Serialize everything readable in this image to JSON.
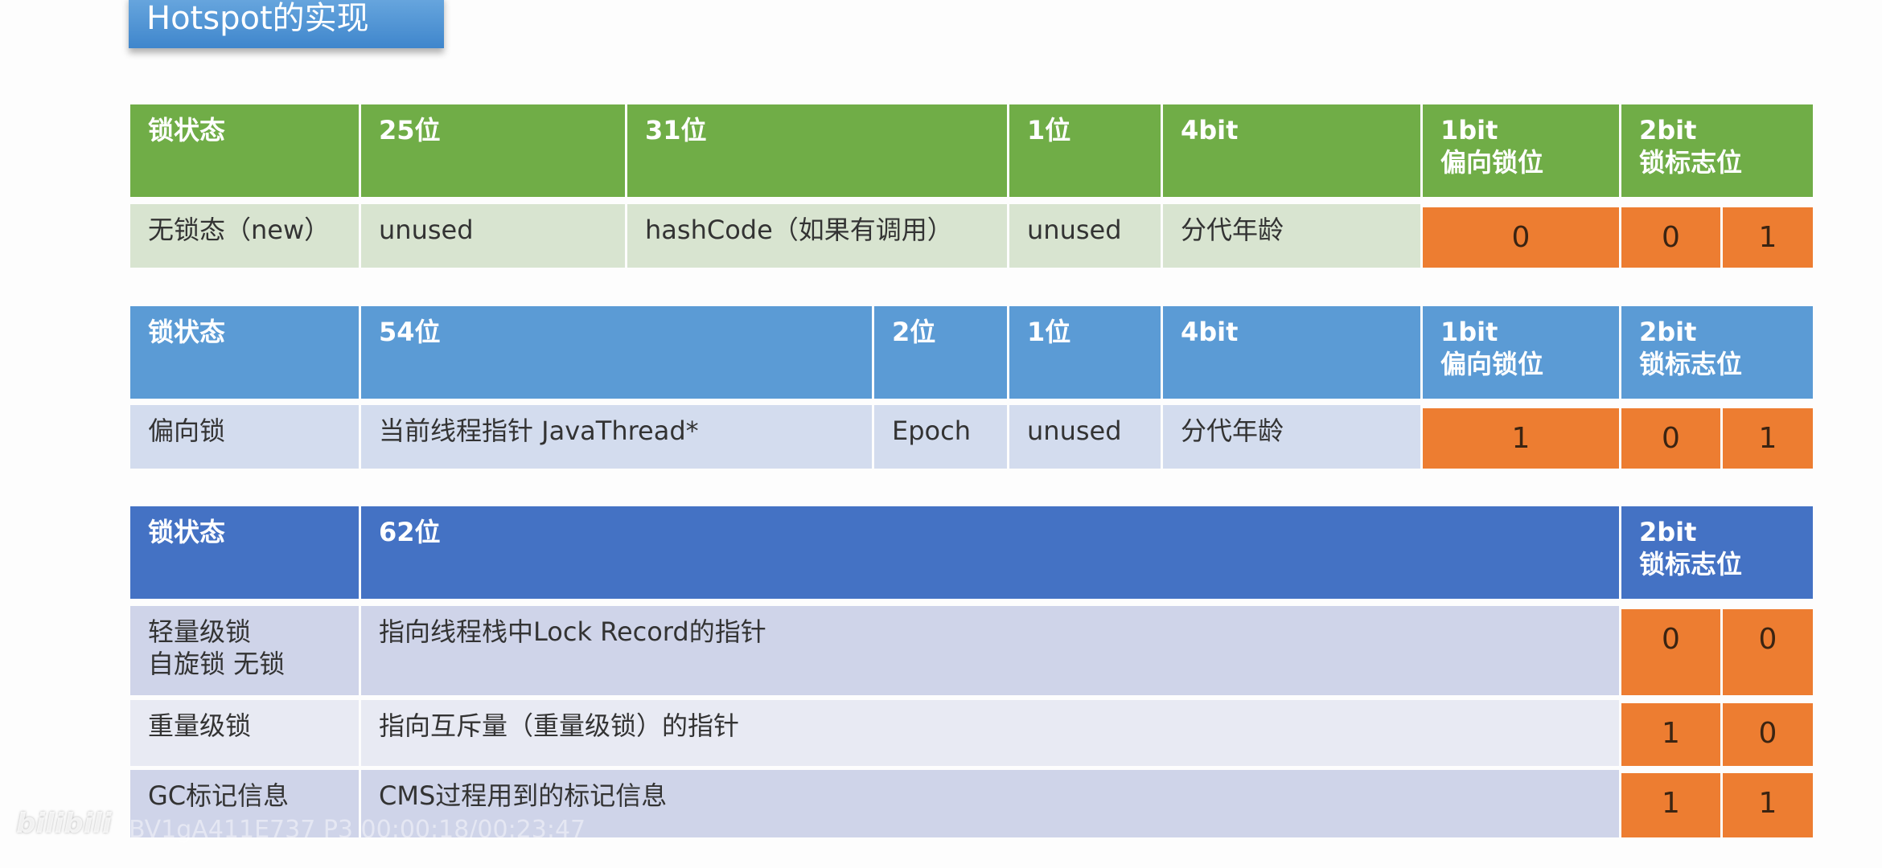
{
  "title": "Hotspot的实现",
  "colors": {
    "green_header": "#70ad47",
    "green_row": "#d8e4d0",
    "blue_header": "#5b9bd5",
    "blue_row": "#d3dcee",
    "darkblue_header": "#4472c4",
    "darkblue_row_a": "#cfd4e9",
    "darkblue_row_b": "#e8eaf3",
    "bit_cell": "#ed7d31"
  },
  "tables": [
    {
      "header": [
        "锁状态",
        "25位",
        "31位",
        "1位",
        "4bit",
        "1bit\n偏向锁位",
        "2bit\n锁标志位"
      ],
      "rows": [
        {
          "cells": [
            "无锁态（new）",
            "unused",
            "hashCode（如果有调用）",
            "unused",
            "分代年龄"
          ],
          "bits": [
            "0",
            "0",
            "1"
          ]
        }
      ]
    },
    {
      "header": [
        "锁状态",
        "54位",
        "2位",
        "1位",
        "4bit",
        "1bit\n偏向锁位",
        "2bit\n锁标志位"
      ],
      "rows": [
        {
          "cells": [
            "偏向锁",
            "当前线程指针 JavaThread*",
            "Epoch",
            "unused",
            "分代年龄"
          ],
          "bits": [
            "1",
            "0",
            "1"
          ]
        }
      ]
    },
    {
      "header": [
        "锁状态",
        "62位",
        "2bit\n锁标志位"
      ],
      "rows": [
        {
          "cells": [
            "轻量级锁\n自旋锁 无锁",
            "指向线程栈中Lock Record的指针"
          ],
          "bits": [
            "0",
            "0"
          ]
        },
        {
          "cells": [
            "重量级锁",
            "指向互斥量（重量级锁）的指针"
          ],
          "bits": [
            "1",
            "0"
          ]
        },
        {
          "cells": [
            "GC标记信息",
            "CMS过程用到的标记信息"
          ],
          "bits": [
            "1",
            "1"
          ]
        }
      ]
    }
  ],
  "watermark": {
    "logo": "bilibili",
    "text": "BV1gA411E737 P3 00:00:18/00:23:47"
  }
}
